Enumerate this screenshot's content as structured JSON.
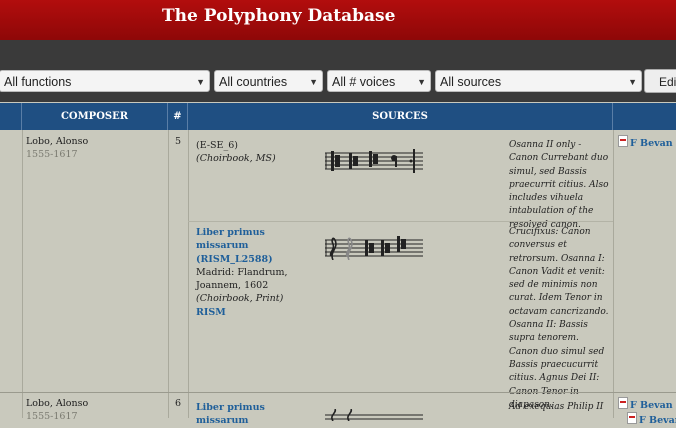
{
  "app": {
    "title": "The Polyphony Database"
  },
  "filters": {
    "functions": "All functions",
    "countries": "All countries",
    "voices": "All # voices",
    "sources": "All sources",
    "edit_label": "Edit"
  },
  "table": {
    "headers": {
      "composer": "COMPOSER",
      "num": "#",
      "sources": "SOURCES"
    },
    "rows": [
      {
        "composer": "Lobo, Alonso",
        "dates": "1555-1617",
        "voices": "5",
        "sources": [
          {
            "source_id": "(E-SE_6)",
            "source_desc": "(Choirbook, MS)",
            "note": "Osanna II only - Canon Currebant duo simul, sed Bassis praecurrit citius. Also includes vihuela intabulation of the resolved canon.",
            "edition": "F Bevan (A"
          },
          {
            "title": "Liber primus missarum (RISM_L2588)",
            "pub": "Madrid: Flandrum, Joannem, 1602",
            "pub_desc": "(Choirbook, Print)",
            "rism": "RISM",
            "note": "Crucifixus: Canon conversus et retrorsum. Osanna I: Canon Vadit et venit: sed de minimis non curat. Idem Tenor in octavam cancrizando. Osanna II: Bassis supra tenorem. Canon duo simul sed Bassis praecucurrit citius. Agnus Dei II: Canon Tenor in diapason."
          }
        ]
      },
      {
        "composer": "Lobo, Alonso",
        "dates": "1555-1617",
        "voices": "6",
        "sources": [
          {
            "title": "Liber primus missarum",
            "note": "Ad exequias Philip II",
            "edition": "F Bevan (A",
            "edition2": "F Bevan"
          }
        ]
      }
    ]
  },
  "clefs_row1": "𝄡 𝄡 𝄡 𝄢 𝄴",
  "clefs_row2": "𝄞 𝄞 𝄡 𝄡 𝄡"
}
